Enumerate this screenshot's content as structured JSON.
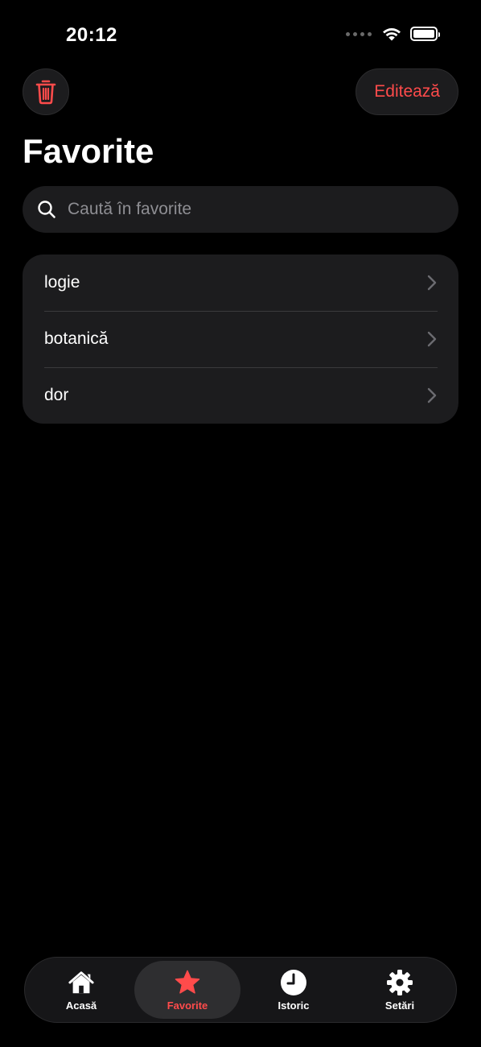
{
  "status": {
    "time": "20:12"
  },
  "header": {
    "edit_label": "Editează",
    "title": "Favorite"
  },
  "search": {
    "placeholder": "Caută în favorite",
    "value": ""
  },
  "favorites": [
    {
      "label": "logie"
    },
    {
      "label": "botanică"
    },
    {
      "label": "dor"
    }
  ],
  "tabs": [
    {
      "label": "Acasă",
      "icon": "house-icon"
    },
    {
      "label": "Favorite",
      "icon": "star-icon",
      "active": true
    },
    {
      "label": "Istoric",
      "icon": "clock-icon"
    },
    {
      "label": "Setări",
      "icon": "gear-icon"
    }
  ],
  "colors": {
    "accent": "#ff4b4b",
    "background": "#000000",
    "card": "#1c1c1e"
  }
}
